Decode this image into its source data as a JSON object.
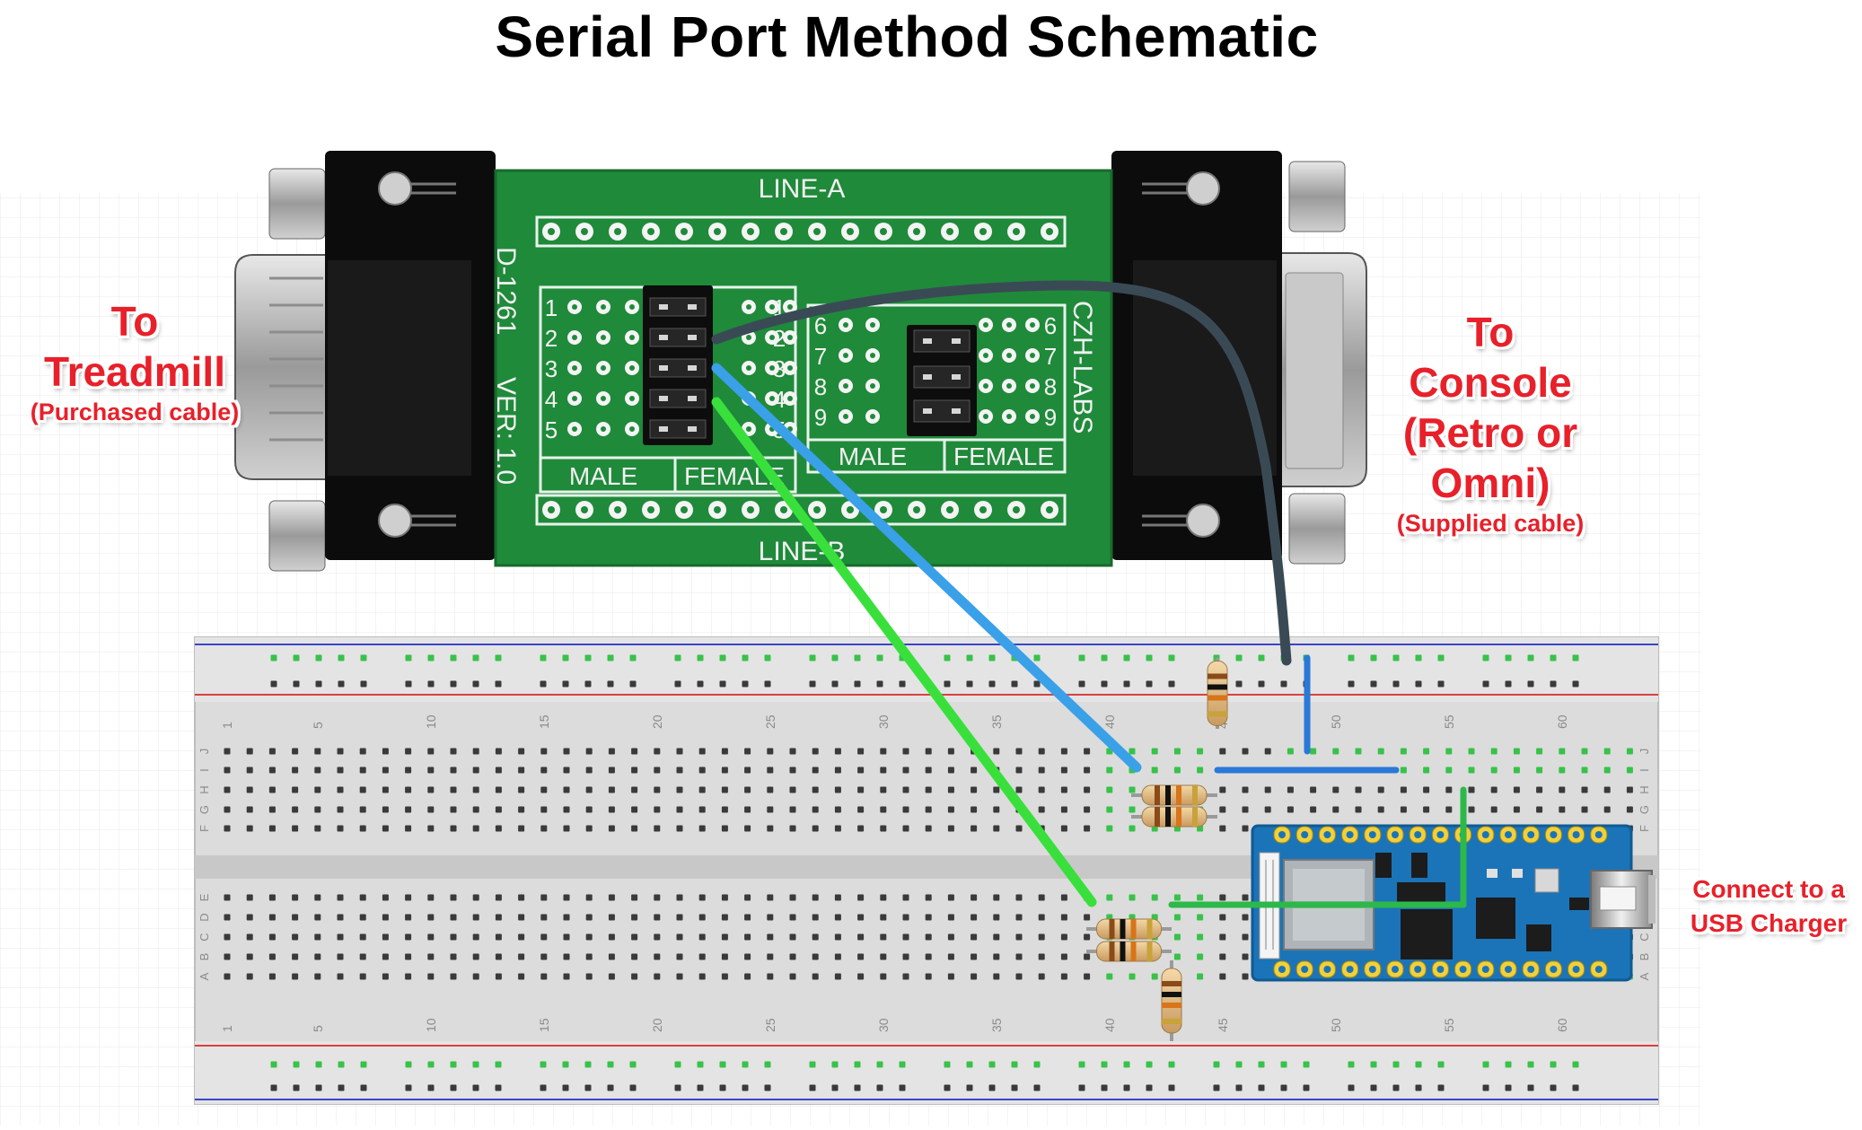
{
  "title": "Serial Port Method Schematic",
  "labels": {
    "treadmill_main": "To\nTreadmill",
    "treadmill_sub": "(Purchased cable)",
    "console_main": "To\nConsole\n(Retro or\nOmni)",
    "console_sub": "(Supplied cable)",
    "usb": "Connect to a\nUSB Charger"
  },
  "pcb": {
    "line_a": "LINE-A",
    "line_b": "LINE-B",
    "model": "D-1261",
    "version": "VER: 1.0",
    "brand": "CZH-LABS",
    "male": "MALE",
    "female": "FEMALE",
    "left_numbers": [
      "1",
      "2",
      "3",
      "4",
      "5"
    ],
    "right_numbers": [
      "6",
      "7",
      "8",
      "9"
    ]
  },
  "breadboard": {
    "column_numbers": [
      "1",
      "5",
      "10",
      "15",
      "20",
      "25",
      "30",
      "35",
      "40",
      "45",
      "50",
      "55",
      "60"
    ],
    "row_letters_top": [
      "J",
      "I",
      "H",
      "G",
      "F"
    ],
    "row_letters_bottom": [
      "E",
      "D",
      "C",
      "B",
      "A"
    ]
  },
  "colors": {
    "label_red": "#e8202a",
    "pcb_green": "#1f8a3a",
    "wire_dark": "#3a4a55",
    "wire_blue": "#3aa0e8",
    "wire_green": "#39e03c",
    "jumper_blue": "#2a78d8",
    "jumper_green": "#2db84a",
    "arduino_blue": "#1b74b8",
    "rail_red": "#d94040",
    "rail_blue": "#3a46c8"
  }
}
